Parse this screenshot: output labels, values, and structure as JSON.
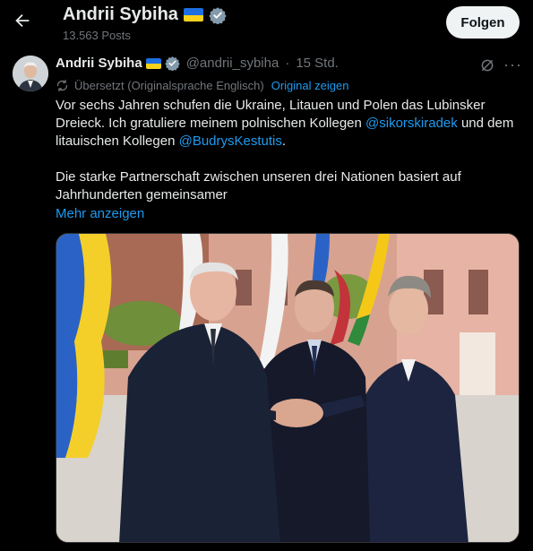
{
  "header": {
    "back_icon": "arrow-left-icon",
    "name": "Andrii Sybiha",
    "posts_count": "13.563 Posts",
    "follow_label": "Folgen"
  },
  "post": {
    "author_name": "Andrii Sybiha",
    "handle": "@andrii_sybiha",
    "separator": "·",
    "time": "15 Std.",
    "translation_note": "Übersetzt (Originalsprache Englisch)",
    "show_original": "Original zeigen",
    "text": {
      "line1_before": "Vor sechs Jahren schufen die Ukraine, Litauen und Polen das Lubinsker Dreieck. Ich gratuliere meinem polnischen Kollegen ",
      "mention1": "@sikorskiradek",
      "line1_mid": " und dem litauischen Kollegen ",
      "mention2": "@BudrysKestutis",
      "line1_end": ".",
      "paragraph2": "Die starke Partnerschaft zwischen unseren drei Nationen basiert auf Jahrhunderten gemeinsamer"
    },
    "show_more": "Mehr anzeigen"
  },
  "colors": {
    "background": "#000000",
    "text": "#e7e9ea",
    "muted": "#71767b",
    "link": "#1d9bf0",
    "button_bg": "#eff3f4",
    "flag_blue": "#1d6ee0",
    "flag_yellow": "#f8d21b"
  }
}
